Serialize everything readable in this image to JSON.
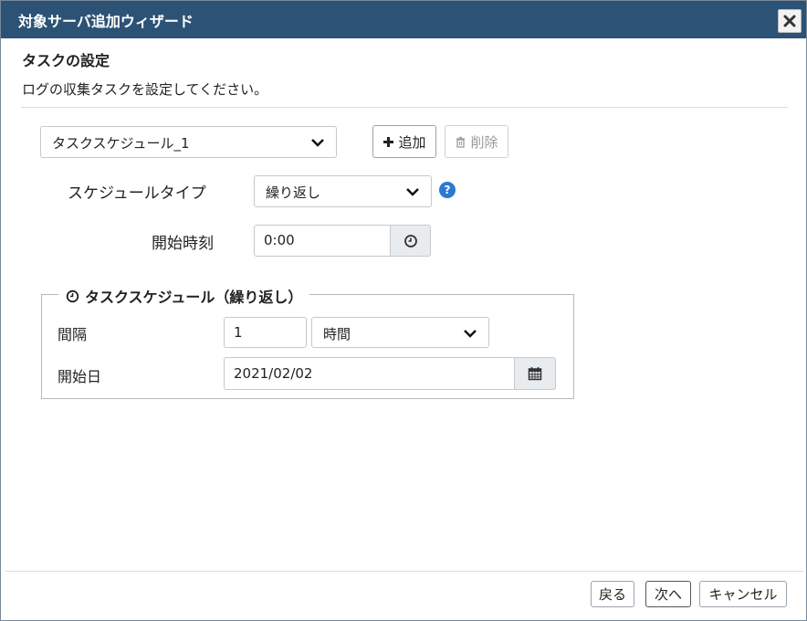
{
  "window": {
    "title": "対象サーバ追加ウィザード",
    "close_icon": "close-icon"
  },
  "section": {
    "title": "タスクの設定",
    "description": "ログの収集タスクを設定してください。"
  },
  "task_select": {
    "value": "タスクスケジュール_1"
  },
  "buttons": {
    "add_label": "追加",
    "delete_label": "削除",
    "add_icon": "plus-icon",
    "delete_icon": "trash-icon"
  },
  "schedule_type": {
    "label": "スケジュールタイプ",
    "value": "繰り返し",
    "help": "?"
  },
  "start_time": {
    "label": "開始時刻",
    "value": "0:00",
    "icon": "clock-icon"
  },
  "schedule_group": {
    "legend": "タスクスケジュール（繰り返し）",
    "interval_label": "間隔",
    "interval_value": "1",
    "interval_unit": "時間",
    "start_date_label": "開始日",
    "start_date_value": "2021/02/02",
    "calendar_icon": "calendar-icon"
  },
  "footer": {
    "back_label": "戻る",
    "next_label": "次へ",
    "cancel_label": "キャンセル"
  },
  "colors": {
    "titlebar": "#2c5375",
    "help": "#2a7ad2"
  }
}
